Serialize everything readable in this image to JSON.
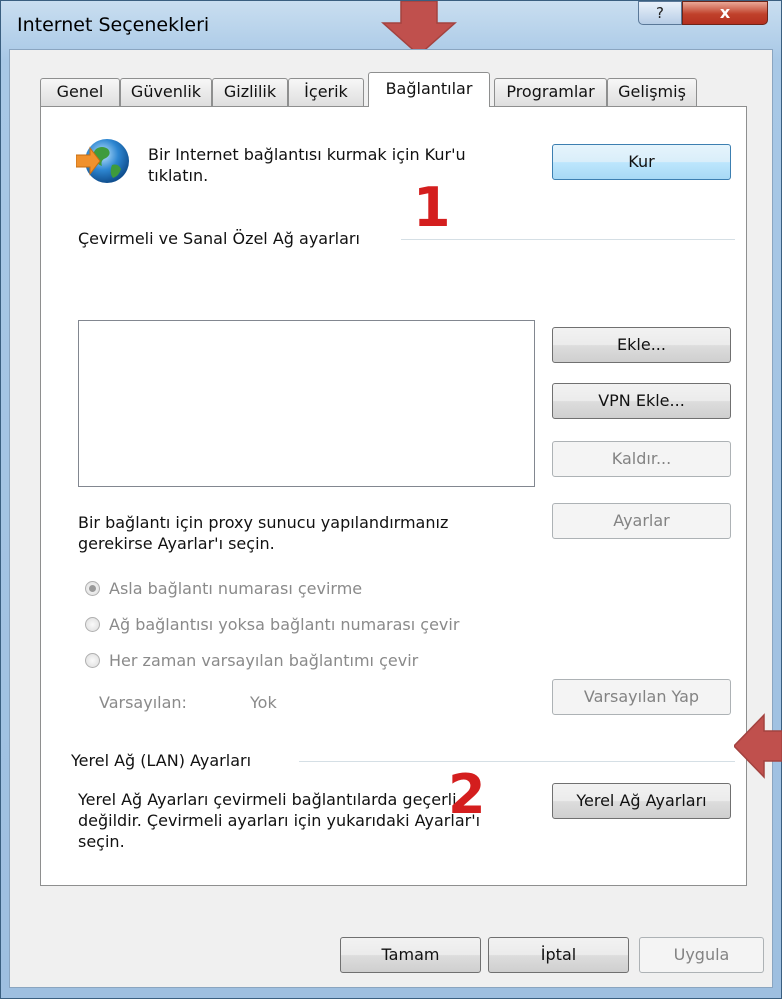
{
  "window": {
    "title": "Internet Seçenekleri",
    "help_label": "?",
    "close_label": "x"
  },
  "tabs": [
    {
      "label": "Genel",
      "active": false
    },
    {
      "label": "Güvenlik",
      "active": false
    },
    {
      "label": "Gizlilik",
      "active": false
    },
    {
      "label": "İçerik",
      "active": false
    },
    {
      "label": "Bağlantılar",
      "active": true
    },
    {
      "label": "Programlar",
      "active": false
    },
    {
      "label": "Gelişmiş",
      "active": false
    }
  ],
  "setup": {
    "icon": "internet-globe-icon",
    "text_line1": "Bir Internet bağlantısı kurmak için Kur'u",
    "text_line2": "tıklatın.",
    "button": "Kur"
  },
  "dialup": {
    "heading": "Çevirmeli ve Sanal Özel Ağ ayarları",
    "add_button": "Ekle...",
    "vpn_button": "VPN Ekle...",
    "remove_button": "Kaldır...",
    "settings_button": "Ayarlar",
    "proxy_text_line1": "Bir bağlantı için proxy sunucu yapılandırmanız",
    "proxy_text_line2": "gerekirse Ayarlar'ı seçin.",
    "radios": [
      {
        "label": "Asla bağlantı numarası çevirme",
        "checked": true
      },
      {
        "label": "Ağ bağlantısı yoksa bağlantı numarası çevir",
        "checked": false
      },
      {
        "label": "Her zaman varsayılan bağlantımı çevir",
        "checked": false
      }
    ],
    "default_label": "Varsayılan:",
    "default_value": "Yok",
    "set_default_button": "Varsayılan Yap"
  },
  "lan": {
    "heading": "Yerel Ağ (LAN) Ayarları",
    "text_line1": "Yerel Ağ Ayarları çevirmeli bağlantılarda geçerli",
    "text_line2": "değildir. Çevirmeli ayarları için yukarıdaki Ayarlar'ı",
    "text_line3": "seçin.",
    "button": "Yerel Ağ Ayarları"
  },
  "footer": {
    "ok": "Tamam",
    "cancel": "İptal",
    "apply": "Uygula"
  },
  "annotations": {
    "step1": "1",
    "step2": "2",
    "arrow_color": "#c0504d",
    "number_color": "#d41e1e"
  }
}
